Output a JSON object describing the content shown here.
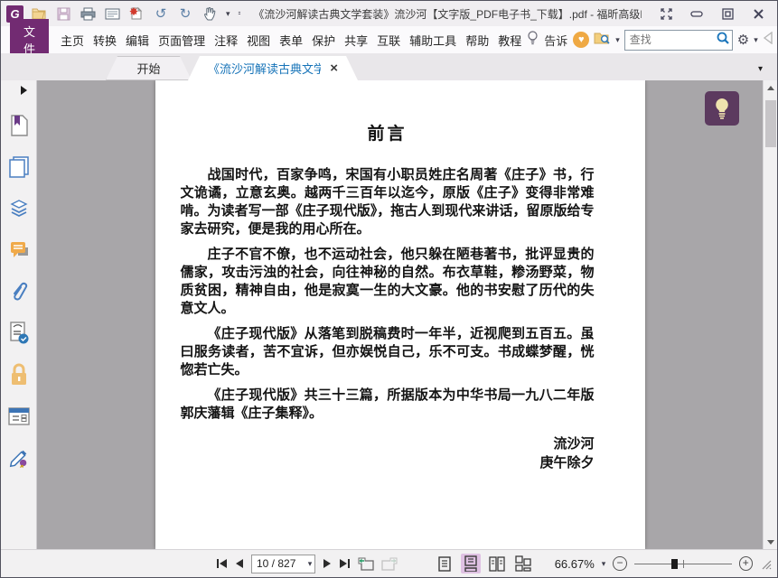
{
  "titlebar": {
    "title": "《流沙河解读古典文学套装》流沙河【文字版_PDF电子书_下载】.pdf - 福昕高级PD...",
    "logo_letter": "G"
  },
  "menubar": {
    "file_label": "文件",
    "items": [
      "主页",
      "转换",
      "编辑",
      "页面管理",
      "注释",
      "视图",
      "表单",
      "保护",
      "共享",
      "互联",
      "辅助工具",
      "帮助",
      "教程"
    ],
    "tell_label": "告诉",
    "search_placeholder": "查找"
  },
  "tabs": {
    "start_label": "开始",
    "doc_label": "《流沙河解读古典文学..."
  },
  "document": {
    "title": "前言",
    "paragraphs": [
      "战国时代，百家争鸣，宋国有小职员姓庄名周著《庄子》书，行文诡谲，立意玄奥。越两千三百年以迄今，原版《庄子》变得非常难啃。为读者写一部《庄子现代版》，拖古人到现代来讲话，留原版给专家去研究，便是我的用心所在。",
      "庄子不官不僚，也不运动社会，他只躲在陋巷著书，批评显贵的儒家，攻击污浊的社会，向往神秘的自然。布衣草鞋，糁汤野菜，物质贫困，精神自由，他是寂寞一生的大文豪。他的书安慰了历代的失意文人。",
      "《庄子现代版》从落笔到脱稿费时一年半，近视爬到五百五。虽曰服务读者，苦不宜诉，但亦娱悦自己，乐不可支。书成蝶梦醒，恍惚若亡失。",
      "《庄子现代版》共三十三篇，所据版本为中华书局一九八二年版郭庆藩辑《庄子集释》。"
    ],
    "signature": [
      "流沙河",
      "庚午除夕"
    ]
  },
  "statusbar": {
    "page_field": "10 / 827",
    "zoom_label": "66.67%"
  },
  "glyphs": {
    "caret_down": "▾",
    "close": "×",
    "gear": "⚙",
    "heart": "♥",
    "undo": "↺",
    "redo": "↻",
    "minus": "−",
    "plus": "+"
  },
  "colors": {
    "accent_purple": "#722b72",
    "active_tab_blue": "#1673b8",
    "doc_background": "#a8a6a9",
    "layout_active_bg": "#dfc1e3",
    "heart_orange": "#efa944"
  }
}
